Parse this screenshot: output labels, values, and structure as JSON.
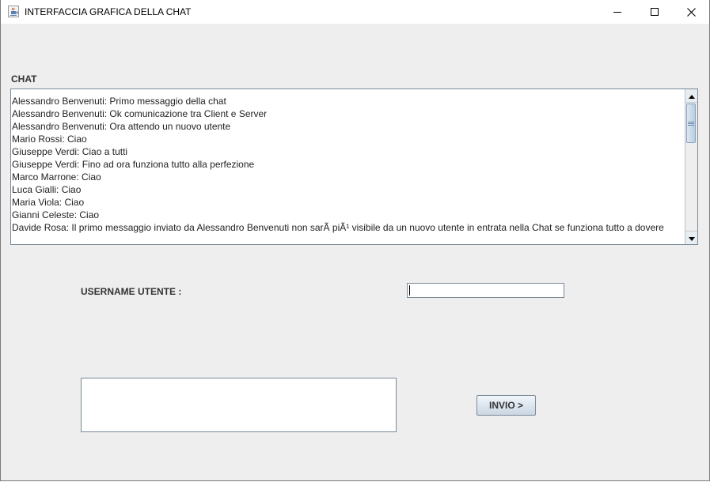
{
  "window": {
    "title": "INTERFACCIA GRAFICA DELLA CHAT",
    "icon": "java-cup-icon",
    "controls": [
      "minimize-icon",
      "maximize-icon",
      "close-icon"
    ]
  },
  "chat": {
    "label": "CHAT",
    "messages": [
      "Alessandro Benvenuti: Primo messaggio della chat",
      "Alessandro Benvenuti: Ok comunicazione tra Client e Server",
      "Alessandro Benvenuti: Ora attendo un nuovo utente",
      "Mario Rossi: Ciao",
      "Giuseppe Verdi: Ciao a tutti",
      "Giuseppe Verdi: Fino ad ora funziona tutto alla perfezione",
      "Marco Marrone: Ciao",
      "Luca Gialli: Ciao",
      "Maria Viola: Ciao",
      "Gianni Celeste: Ciao",
      "Davide Rosa: Il primo messaggio inviato da Alessandro Benvenuti non sarÃ  piÃ¹ visibile da un nuovo utente in entrata nella Chat se funziona tutto a dovere"
    ]
  },
  "form": {
    "username_label": "USERNAME UTENTE :",
    "username_value": "",
    "message_value": "",
    "send_label": "INVIO >"
  },
  "colors": {
    "window_bg": "#eeeeee",
    "titlebar_bg": "#ffffff",
    "field_border": "#7a8a99",
    "button_gradient_top": "#f2f6fa",
    "button_gradient_bottom": "#c9d6e3"
  }
}
